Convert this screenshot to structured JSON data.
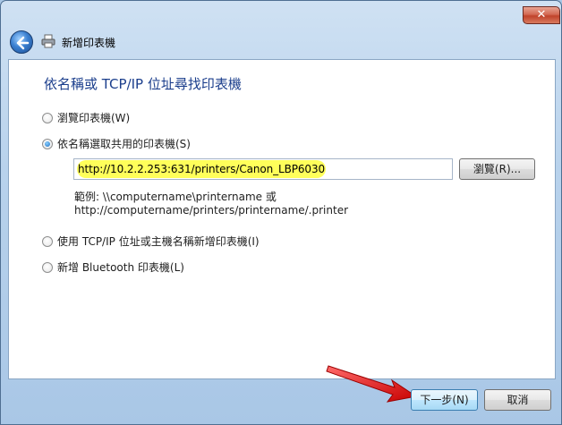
{
  "window": {
    "close_glyph": "✕",
    "title": "新增印表機"
  },
  "content": {
    "heading": "依名稱或 TCP/IP 位址尋找印表機",
    "options": [
      {
        "label": "瀏覽印表機(W)",
        "checked": false
      },
      {
        "label": "依名稱選取共用的印表機(S)",
        "checked": true
      },
      {
        "label": "使用 TCP/IP 位址或主機名稱新增印表機(I)",
        "checked": false
      },
      {
        "label": "新增 Bluetooth 印表機(L)",
        "checked": false
      }
    ],
    "printer_path": "http://10.2.2.253:631/printers/Canon_LBP6030",
    "browse_label": "瀏覽(R)...",
    "example_line1": "範例: \\\\computername\\printername 或",
    "example_line2": "http://computername/printers/printername/.printer"
  },
  "buttons": {
    "next_label": "下一步(N)",
    "cancel_label": "取消"
  },
  "colors": {
    "heading": "#1b3e8c",
    "highlight": "#ffff5a",
    "arrow": "#e01010"
  }
}
